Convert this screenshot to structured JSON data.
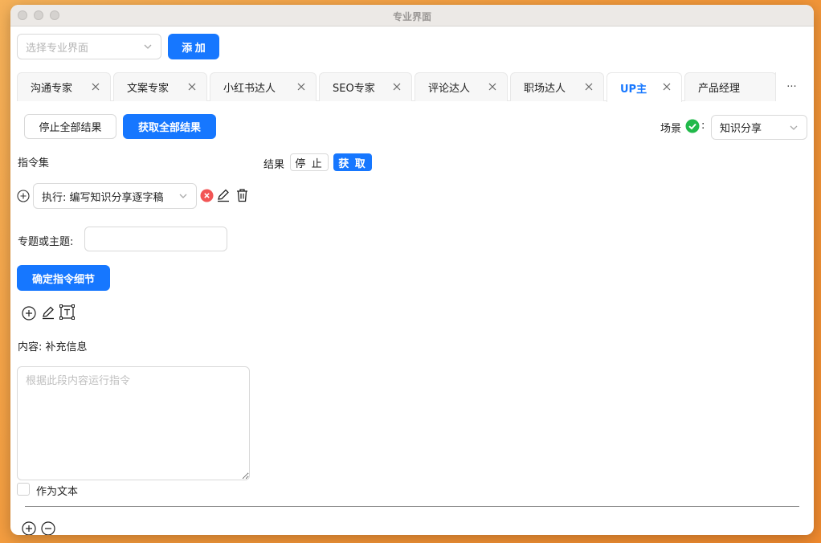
{
  "window": {
    "title": "专业界面"
  },
  "toolbar": {
    "select_placeholder": "选择专业界面",
    "add_label": "添 加"
  },
  "tabs": [
    {
      "label": "沟通专家"
    },
    {
      "label": "文案专家"
    },
    {
      "label": "小红书达人"
    },
    {
      "label": "SEO专家"
    },
    {
      "label": "评论达人"
    },
    {
      "label": "职场达人"
    },
    {
      "label": "UP主",
      "active": true
    },
    {
      "label": "产品经理"
    }
  ],
  "tabs_more": "···",
  "actions": {
    "stop_all": "停止全部结果",
    "get_all": "获取全部结果",
    "scene_label": "场景",
    "scene_colon": ":",
    "scene_value": "知识分享"
  },
  "commands": {
    "title": "指令集",
    "selected": "执行: 编写知识分享逐字稿"
  },
  "results": {
    "label": "结果",
    "stop": "停 止",
    "get": "获 取"
  },
  "topic": {
    "label": "专题或主题:",
    "value": ""
  },
  "confirm_label": "确定指令细节",
  "content": {
    "label": "内容: 补充信息",
    "placeholder": "根据此段内容运行指令",
    "value": "",
    "as_text_label": "作为文本"
  },
  "colors": {
    "primary": "#1677ff",
    "success": "#21b94a",
    "danger": "#f25555"
  }
}
